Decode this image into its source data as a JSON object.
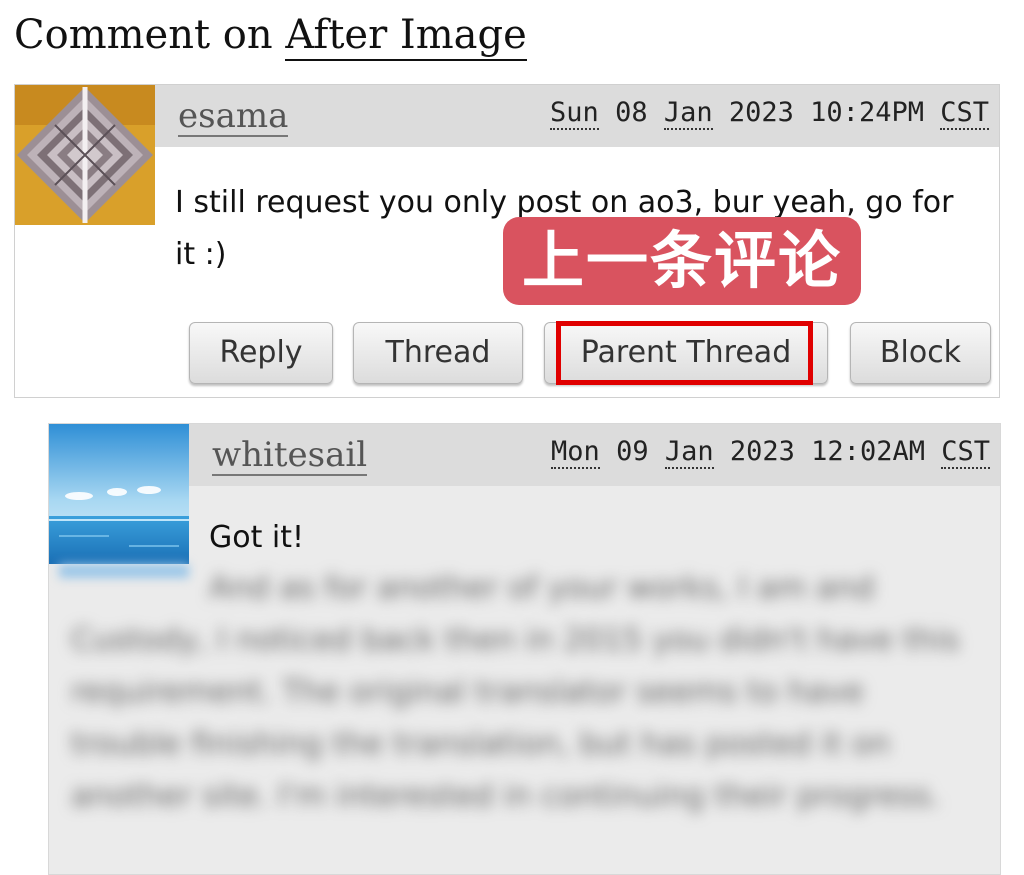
{
  "page": {
    "heading_prefix": "Comment on",
    "work_title": "After Image"
  },
  "comments": [
    {
      "username": "esama",
      "day": "Sun",
      "date_mid": " 08 ",
      "month": "Jan",
      "date_rest": " 2023 10:24PM ",
      "tz": "CST",
      "body": "I still request you only post on ao3, bur yeah, go for it :)",
      "buttons": {
        "reply": "Reply",
        "thread": "Thread",
        "parent_thread": "Parent Thread",
        "block": "Block"
      }
    },
    {
      "username": "whitesail",
      "day": "Mon",
      "date_mid": " 09 ",
      "month": "Jan",
      "date_rest": " 2023 12:02AM ",
      "tz": "CST",
      "body_first_line": "Got it!",
      "body_blurred": "And as for another of your works, I am and Custody, I noticed back then in 2015 you didn't have this requirement. The original translator seems to have trouble finishing the translation, but has posted it on another site. I'm interested in continuing their progress."
    }
  ],
  "annotation": {
    "label": "上一条评论",
    "color": "#d9535f",
    "highlight_color": "#e00000"
  },
  "icons": {
    "avatar1": "maze-avatar-icon",
    "avatar2": "sea-avatar-icon"
  }
}
